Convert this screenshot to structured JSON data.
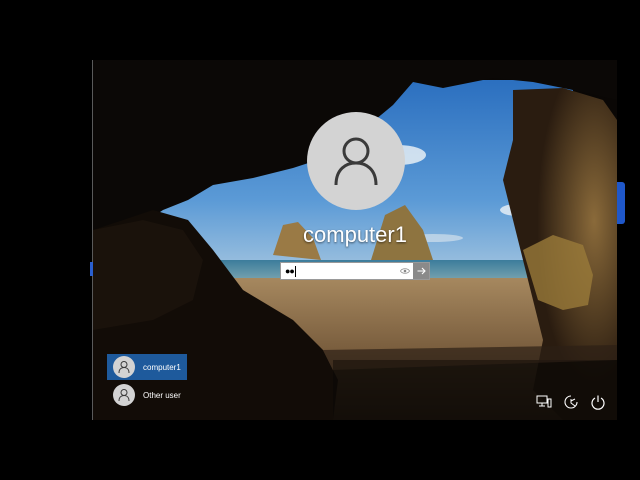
{
  "login": {
    "username": "computer1",
    "password_mask": "●●",
    "reveal_icon": "eye-icon",
    "submit_icon": "arrow-right-icon"
  },
  "user_list": [
    {
      "label": "computer1",
      "selected": true,
      "icon": "user-icon"
    },
    {
      "label": "Other user",
      "selected": false,
      "icon": "user-icon"
    }
  ],
  "system_icons": [
    "network-icon",
    "ease-of-access-icon",
    "power-icon"
  ],
  "colors": {
    "selected_tile": "#1e5a9c",
    "avatar_bg": "#d3d3d3",
    "accent_tab": "#1f57c9"
  }
}
